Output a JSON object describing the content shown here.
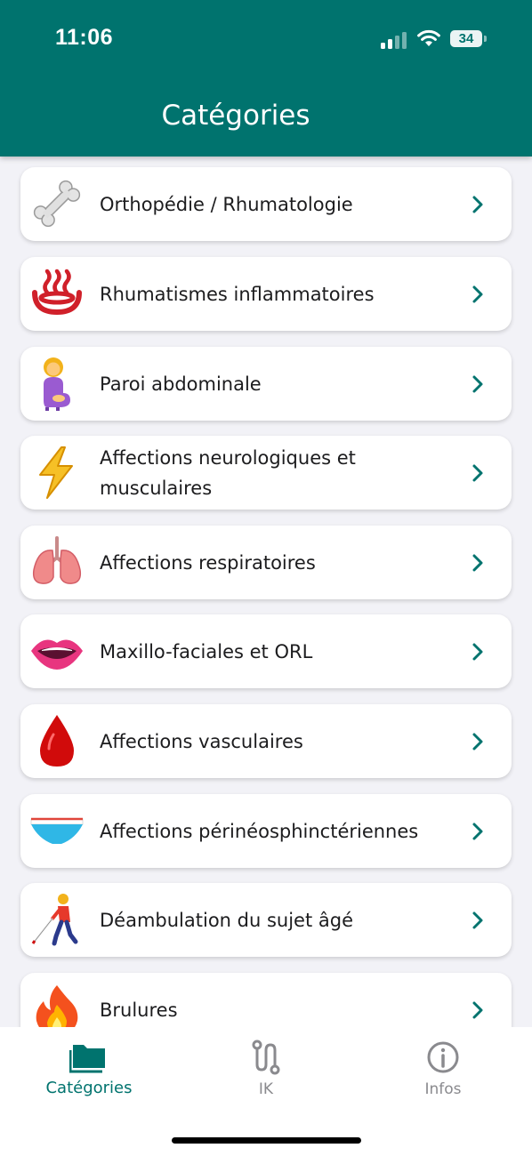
{
  "status_bar": {
    "time": "11:06",
    "battery": "34",
    "icons": [
      "signal-icon",
      "wifi-icon",
      "battery-icon"
    ]
  },
  "header": {
    "title": "Catégories",
    "background": "#00736e"
  },
  "categories": [
    {
      "label": "Orthopédie / Rhumatologie",
      "icon": "bone-icon"
    },
    {
      "label": "Rhumatismes inflammatoires",
      "icon": "hot-springs-icon"
    },
    {
      "label": "Paroi abdominale",
      "icon": "pregnant-woman-icon"
    },
    {
      "label": "Affections neurologiques et musculaires",
      "icon": "lightning-icon"
    },
    {
      "label": "Affections respiratoires",
      "icon": "lungs-icon"
    },
    {
      "label": "Maxillo-faciales et ORL",
      "icon": "mouth-icon"
    },
    {
      "label": "Affections vasculaires",
      "icon": "drop-of-blood-icon"
    },
    {
      "label": "Affections périnéosphinctériennes",
      "icon": "briefs-icon"
    },
    {
      "label": "Déambulation du sujet âgé",
      "icon": "person-with-cane-icon"
    },
    {
      "label": "Brulures",
      "icon": "fire-icon"
    }
  ],
  "tabs": [
    {
      "label": "Catégories",
      "icon": "folder-icon",
      "active": true
    },
    {
      "label": "IK",
      "icon": "route-icon",
      "active": false
    },
    {
      "label": "Infos",
      "icon": "info-icon",
      "active": false
    }
  ],
  "colors": {
    "accent": "#00736e",
    "inactive": "#8a8a8e",
    "background": "#f2f2f7"
  }
}
